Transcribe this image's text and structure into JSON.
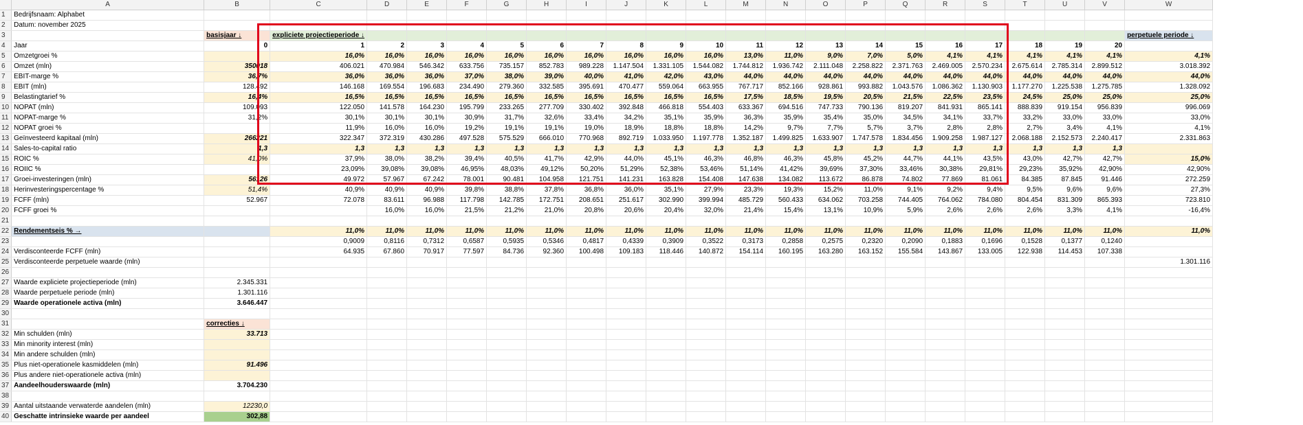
{
  "columns": [
    "A",
    "B",
    "C",
    "D",
    "E",
    "F",
    "G",
    "H",
    "I",
    "J",
    "K",
    "L",
    "M",
    "N",
    "O",
    "P",
    "Q",
    "R",
    "S",
    "T",
    "U",
    "V",
    "W"
  ],
  "rows": [
    {
      "n": "1",
      "A": "Bedrijfsnaam: Alphabet"
    },
    {
      "n": "2",
      "A": "Datum: november 2025"
    },
    {
      "n": "3",
      "B": "basisjaar ↓",
      "C": "expliciete projectieperiode ↓",
      "W": "perpetuele periode ↓"
    },
    {
      "n": "4",
      "A": "Jaar",
      "B": "0",
      "C": "1",
      "D": "2",
      "E": "3",
      "F": "4",
      "G": "5",
      "H": "6",
      "I": "7",
      "J": "8",
      "K": "9",
      "L": "10",
      "M": "11",
      "N": "12",
      "O": "13",
      "P": "14",
      "Q": "15",
      "R": "16",
      "S": "17",
      "T": "18",
      "U": "19",
      "V": "20"
    },
    {
      "n": "5",
      "A": "Omzetgroei %",
      "C": "16,0%",
      "D": "16,0%",
      "E": "16,0%",
      "F": "16,0%",
      "G": "16,0%",
      "H": "16,0%",
      "I": "16,0%",
      "J": "16,0%",
      "K": "16,0%",
      "L": "16,0%",
      "M": "13,0%",
      "N": "11,0%",
      "O": "9,0%",
      "P": "7,0%",
      "Q": "5,0%",
      "R": "4,1%",
      "S": "4,1%",
      "T": "4,1%",
      "U": "4,1%",
      "V": "4,1%",
      "W": "4,1%"
    },
    {
      "n": "6",
      "A": "Omzet (mln)",
      "B": "350018",
      "C": "406.021",
      "D": "470.984",
      "E": "546.342",
      "F": "633.756",
      "G": "735.157",
      "H": "852.783",
      "I": "989.228",
      "J": "1.147.504",
      "K": "1.331.105",
      "L": "1.544.082",
      "M": "1.744.812",
      "N": "1.936.742",
      "O": "2.111.048",
      "P": "2.258.822",
      "Q": "2.371.763",
      "R": "2.469.005",
      "S": "2.570.234",
      "T": "2.675.614",
      "U": "2.785.314",
      "V": "2.899.512",
      "W": "3.018.392"
    },
    {
      "n": "7",
      "A": "EBIT-marge %",
      "B": "36,7%",
      "C": "36,0%",
      "D": "36,0%",
      "E": "36,0%",
      "F": "37,0%",
      "G": "38,0%",
      "H": "39,0%",
      "I": "40,0%",
      "J": "41,0%",
      "K": "42,0%",
      "L": "43,0%",
      "M": "44,0%",
      "N": "44,0%",
      "O": "44,0%",
      "P": "44,0%",
      "Q": "44,0%",
      "R": "44,0%",
      "S": "44,0%",
      "T": "44,0%",
      "U": "44,0%",
      "V": "44,0%",
      "W": "44,0%"
    },
    {
      "n": "8",
      "A": "EBIT (mln)",
      "B": "128.492",
      "C": "146.168",
      "D": "169.554",
      "E": "196.683",
      "F": "234.490",
      "G": "279.360",
      "H": "332.585",
      "I": "395.691",
      "J": "470.477",
      "K": "559.064",
      "L": "663.955",
      "M": "767.717",
      "N": "852.166",
      "O": "928.861",
      "P": "993.882",
      "Q": "1.043.576",
      "R": "1.086.362",
      "S": "1.130.903",
      "T": "1.177.270",
      "U": "1.225.538",
      "V": "1.275.785",
      "W": "1.328.092"
    },
    {
      "n": "9",
      "A": "Belastingtarief %",
      "B": "16,4%",
      "C": "16,5%",
      "D": "16,5%",
      "E": "16,5%",
      "F": "16,5%",
      "G": "16,5%",
      "H": "16,5%",
      "I": "16,5%",
      "J": "16,5%",
      "K": "16,5%",
      "L": "16,5%",
      "M": "17,5%",
      "N": "18,5%",
      "O": "19,5%",
      "P": "20,5%",
      "Q": "21,5%",
      "R": "22,5%",
      "S": "23,5%",
      "T": "24,5%",
      "U": "25,0%",
      "V": "25,0%",
      "W": "25,0%"
    },
    {
      "n": "10",
      "A": "NOPAT (mln)",
      "B": "109.093",
      "C": "122.050",
      "D": "141.578",
      "E": "164.230",
      "F": "195.799",
      "G": "233.265",
      "H": "277.709",
      "I": "330.402",
      "J": "392.848",
      "K": "466.818",
      "L": "554.403",
      "M": "633.367",
      "N": "694.516",
      "O": "747.733",
      "P": "790.136",
      "Q": "819.207",
      "R": "841.931",
      "S": "865.141",
      "T": "888.839",
      "U": "919.154",
      "V": "956.839",
      "W": "996.069"
    },
    {
      "n": "11",
      "A": "NOPAT-marge %",
      "B": "31,2%",
      "C": "30,1%",
      "D": "30,1%",
      "E": "30,1%",
      "F": "30,9%",
      "G": "31,7%",
      "H": "32,6%",
      "I": "33,4%",
      "J": "34,2%",
      "K": "35,1%",
      "L": "35,9%",
      "M": "36,3%",
      "N": "35,9%",
      "O": "35,4%",
      "P": "35,0%",
      "Q": "34,5%",
      "R": "34,1%",
      "S": "33,7%",
      "T": "33,2%",
      "U": "33,0%",
      "V": "33,0%",
      "W": "33,0%"
    },
    {
      "n": "12",
      "A": "NOPAT groei %",
      "C": "11,9%",
      "D": "16,0%",
      "E": "16,0%",
      "F": "19,2%",
      "G": "19,1%",
      "H": "19,1%",
      "I": "19,0%",
      "J": "18,9%",
      "K": "18,8%",
      "L": "18,8%",
      "M": "14,2%",
      "N": "9,7%",
      "O": "7,7%",
      "P": "5,7%",
      "Q": "3,7%",
      "R": "2,8%",
      "S": "2,8%",
      "T": "2,7%",
      "U": "3,4%",
      "V": "4,1%",
      "W": "4,1%"
    },
    {
      "n": "13",
      "A": "Geïnvesteerd kapitaal (mln)",
      "B": "266221",
      "C": "322.347",
      "D": "372.319",
      "E": "430.286",
      "F": "497.528",
      "G": "575.529",
      "H": "666.010",
      "I": "770.968",
      "J": "892.719",
      "K": "1.033.950",
      "L": "1.197.778",
      "M": "1.352.187",
      "N": "1.499.825",
      "O": "1.633.907",
      "P": "1.747.578",
      "Q": "1.834.456",
      "R": "1.909.258",
      "S": "1.987.127",
      "T": "2.068.188",
      "U": "2.152.573",
      "V": "2.240.417",
      "W": "2.331.863"
    },
    {
      "n": "14",
      "A": "Sales-to-capital ratio",
      "B": "1,3",
      "C": "1,3",
      "D": "1,3",
      "E": "1,3",
      "F": "1,3",
      "G": "1,3",
      "H": "1,3",
      "I": "1,3",
      "J": "1,3",
      "K": "1,3",
      "L": "1,3",
      "M": "1,3",
      "N": "1,3",
      "O": "1,3",
      "P": "1,3",
      "Q": "1,3",
      "R": "1,3",
      "S": "1,3",
      "T": "1,3",
      "U": "1,3",
      "V": "1,3"
    },
    {
      "n": "15",
      "A": "ROIC %",
      "B": "41,0%",
      "C": "37,9%",
      "D": "38,0%",
      "E": "38,2%",
      "F": "39,4%",
      "G": "40,5%",
      "H": "41,7%",
      "I": "42,9%",
      "J": "44,0%",
      "K": "45,1%",
      "L": "46,3%",
      "M": "46,8%",
      "N": "46,3%",
      "O": "45,8%",
      "P": "45,2%",
      "Q": "44,7%",
      "R": "44,1%",
      "S": "43,5%",
      "T": "43,0%",
      "U": "42,7%",
      "V": "42,7%",
      "W": "15,0%"
    },
    {
      "n": "16",
      "A": "ROIIC %",
      "C": "23,09%",
      "D": "39,08%",
      "E": "39,08%",
      "F": "46,95%",
      "G": "48,03%",
      "H": "49,12%",
      "I": "50,20%",
      "J": "51,29%",
      "K": "52,38%",
      "L": "53,46%",
      "M": "51,14%",
      "N": "41,42%",
      "O": "39,69%",
      "P": "37,30%",
      "Q": "33,46%",
      "R": "30,38%",
      "S": "29,81%",
      "T": "29,23%",
      "U": "35,92%",
      "V": "42,90%",
      "W": "42,90%"
    },
    {
      "n": "17",
      "A": "Groei-investeringen (mln)",
      "B": "56126",
      "C": "49.972",
      "D": "57.967",
      "E": "67.242",
      "F": "78.001",
      "G": "90.481",
      "H": "104.958",
      "I": "121.751",
      "J": "141.231",
      "K": "163.828",
      "L": "154.408",
      "M": "147.638",
      "N": "134.082",
      "O": "113.672",
      "P": "86.878",
      "Q": "74.802",
      "R": "77.869",
      "S": "81.061",
      "T": "84.385",
      "U": "87.845",
      "V": "91.446",
      "W": "272.259"
    },
    {
      "n": "18",
      "A": "Herinvesteringspercentage %",
      "B": "51,4%",
      "C": "40,9%",
      "D": "40,9%",
      "E": "40,9%",
      "F": "39,8%",
      "G": "38,8%",
      "H": "37,8%",
      "I": "36,8%",
      "J": "36,0%",
      "K": "35,1%",
      "L": "27,9%",
      "M": "23,3%",
      "N": "19,3%",
      "O": "15,2%",
      "P": "11,0%",
      "Q": "9,1%",
      "R": "9,2%",
      "S": "9,4%",
      "T": "9,5%",
      "U": "9,6%",
      "V": "9,6%",
      "W": "27,3%"
    },
    {
      "n": "19",
      "A": "FCFF (mln)",
      "B": "52.967",
      "C": "72.078",
      "D": "83.611",
      "E": "96.988",
      "F": "117.798",
      "G": "142.785",
      "H": "172.751",
      "I": "208.651",
      "J": "251.617",
      "K": "302.990",
      "L": "399.994",
      "M": "485.729",
      "N": "560.433",
      "O": "634.062",
      "P": "703.258",
      "Q": "744.405",
      "R": "764.062",
      "S": "784.080",
      "T": "804.454",
      "U": "831.309",
      "V": "865.393",
      "W": "723.810"
    },
    {
      "n": "20",
      "A": "FCFF groei %",
      "D": "16,0%",
      "E": "16,0%",
      "F": "21,5%",
      "G": "21,2%",
      "H": "21,0%",
      "I": "20,8%",
      "J": "20,6%",
      "K": "20,4%",
      "L": "32,0%",
      "M": "21,4%",
      "N": "15,4%",
      "O": "13,1%",
      "P": "10,9%",
      "Q": "5,9%",
      "R": "2,6%",
      "S": "2,6%",
      "T": "2,6%",
      "U": "3,3%",
      "V": "4,1%",
      "W": "-16,4%"
    },
    {
      "n": "21"
    },
    {
      "n": "22",
      "A": "Rendementseis % →",
      "C": "11,0%",
      "D": "11,0%",
      "E": "11,0%",
      "F": "11,0%",
      "G": "11,0%",
      "H": "11,0%",
      "I": "11,0%",
      "J": "11,0%",
      "K": "11,0%",
      "L": "11,0%",
      "M": "11,0%",
      "N": "11,0%",
      "O": "11,0%",
      "P": "11,0%",
      "Q": "11,0%",
      "R": "11,0%",
      "S": "11,0%",
      "T": "11,0%",
      "U": "11,0%",
      "V": "11,0%",
      "W": "11,0%"
    },
    {
      "n": "23",
      "C": "0,9009",
      "D": "0,8116",
      "E": "0,7312",
      "F": "0,6587",
      "G": "0,5935",
      "H": "0,5346",
      "I": "0,4817",
      "J": "0,4339",
      "K": "0,3909",
      "L": "0,3522",
      "M": "0,3173",
      "N": "0,2858",
      "O": "0,2575",
      "P": "0,2320",
      "Q": "0,2090",
      "R": "0,1883",
      "S": "0,1696",
      "T": "0,1528",
      "U": "0,1377",
      "V": "0,1240"
    },
    {
      "n": "24",
      "A": "Verdisconteerde FCFF (mln)",
      "C": "64.935",
      "D": "67.860",
      "E": "70.917",
      "F": "77.597",
      "G": "84.736",
      "H": "92.360",
      "I": "100.498",
      "J": "109.183",
      "K": "118.446",
      "L": "140.872",
      "M": "154.114",
      "N": "160.195",
      "O": "163.280",
      "P": "163.152",
      "Q": "155.584",
      "R": "143.867",
      "S": "133.005",
      "T": "122.938",
      "U": "114.453",
      "V": "107.338"
    },
    {
      "n": "25",
      "A": "Verdisconteerde perpetuele waarde (mln)",
      "W": "1.301.116"
    },
    {
      "n": "26"
    },
    {
      "n": "27",
      "A": "Waarde expliciete projectieperiode (mln)",
      "B": "2.345.331"
    },
    {
      "n": "28",
      "A": "Waarde perpetuele periode (mln)",
      "B": "1.301.116"
    },
    {
      "n": "29",
      "A": "Waarde operationele activa (mln)",
      "B": "3.646.447"
    },
    {
      "n": "30"
    },
    {
      "n": "31",
      "B": "correcties ↓"
    },
    {
      "n": "32",
      "A": "Min schulden (mln)",
      "B": "33.713"
    },
    {
      "n": "33",
      "A": "Min minority interest (mln)"
    },
    {
      "n": "34",
      "A": "Min andere schulden (mln)"
    },
    {
      "n": "35",
      "A": "Plus niet-operationele kasmiddelen (mln)",
      "B": "91.496"
    },
    {
      "n": "36",
      "A": "Plus andere niet-operationele activa (mln)"
    },
    {
      "n": "37",
      "A": "Aandeelhouderswaarde (mln)",
      "B": "3.704.230"
    },
    {
      "n": "38"
    },
    {
      "n": "39",
      "A": "Aantal uitstaande verwaterde aandelen (mln)",
      "B": "12230,0"
    },
    {
      "n": "40",
      "A": "Geschatte intrinsieke waarde per aandeel",
      "B": "302,88"
    }
  ],
  "colors": {
    "input": "#fdf3d6",
    "basisjaar": "#fbe3d6",
    "projectie": "#e2efd9",
    "rendementseis": "#d9e3ee",
    "result": "#a9d08e",
    "highlight": "#e0001b"
  }
}
